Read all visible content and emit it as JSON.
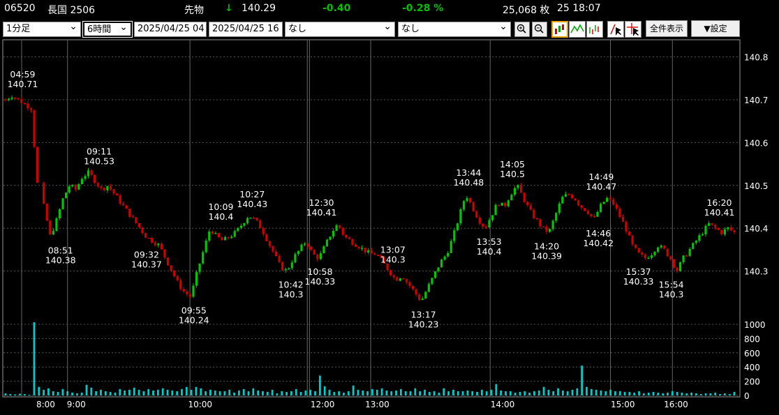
{
  "header": {
    "code": "06520",
    "name": "長国 2506",
    "kind": "先物",
    "arrow": "↓",
    "price": "140.29",
    "change": "-0.40",
    "change_pct": "-0.28 %",
    "volume": "25,068 枚",
    "datetime": "25 18:07",
    "colors": {
      "up": "#00c000",
      "text": "#ffffff"
    }
  },
  "toolbar": {
    "interval": "1分足",
    "span": "6時間",
    "from": "2025/04/25 04",
    "to": "2025/04/25 16",
    "indicator1": "なし",
    "indicator2": "なし",
    "zoom_in_icon": "zoom-in-icon",
    "zoom_out_icon": "zoom-out-icon",
    "show_all": "全件表示",
    "settings": "▼設定"
  },
  "chart_data": {
    "type": "candlestick",
    "y_ticks": [
      "140.8",
      "140.7",
      "140.6",
      "140.5",
      "140.4",
      "140.3"
    ],
    "ylim": [
      140.2,
      140.84
    ],
    "volume_ticks": [
      "1000",
      "800",
      "600",
      "400",
      "200",
      "0"
    ],
    "volume_lim": [
      0,
      1000
    ],
    "x_ticks": [
      "8:00",
      "9:00",
      "10:00",
      "12:00",
      "13:00",
      "14:00",
      "15:00",
      "16:00"
    ],
    "colors": {
      "up": "#00c800",
      "down": "#d00000",
      "volume": "#00cccc",
      "grid": "#666666"
    },
    "annotations": [
      {
        "time": "04:59",
        "price": "140.71",
        "pos": "above"
      },
      {
        "time": "08:51",
        "price": "140.38",
        "pos": "below"
      },
      {
        "time": "09:11",
        "price": "140.53",
        "pos": "above"
      },
      {
        "time": "09:32",
        "price": "140.37",
        "pos": "below"
      },
      {
        "time": "09:55",
        "price": "140.24",
        "pos": "below"
      },
      {
        "time": "10:09",
        "price": "140.4",
        "pos": "above"
      },
      {
        "time": "10:27",
        "price": "140.43",
        "pos": "above"
      },
      {
        "time": "10:42",
        "price": "140.3",
        "pos": "below"
      },
      {
        "time": "10:58",
        "price": "140.33",
        "pos": "below"
      },
      {
        "time": "12:30",
        "price": "140.41",
        "pos": "above"
      },
      {
        "time": "13:07",
        "price": "140.3",
        "pos": "above"
      },
      {
        "time": "13:17",
        "price": "140.23",
        "pos": "below"
      },
      {
        "time": "13:44",
        "price": "140.48",
        "pos": "above"
      },
      {
        "time": "13:53",
        "price": "140.4",
        "pos": "below"
      },
      {
        "time": "14:05",
        "price": "140.5",
        "pos": "above"
      },
      {
        "time": "14:20",
        "price": "140.39",
        "pos": "below"
      },
      {
        "time": "14:46",
        "price": "140.42",
        "pos": "below"
      },
      {
        "time": "14:49",
        "price": "140.47",
        "pos": "above"
      },
      {
        "time": "15:37",
        "price": "140.33",
        "pos": "below"
      },
      {
        "time": "15:54",
        "price": "140.3",
        "pos": "below"
      },
      {
        "time": "16:20",
        "price": "140.41",
        "pos": "above"
      }
    ],
    "price_path": [
      140.7,
      140.71,
      140.7,
      140.69,
      140.68,
      140.5,
      140.45,
      140.38,
      140.42,
      140.47,
      140.5,
      140.49,
      140.52,
      140.53,
      140.51,
      140.49,
      140.5,
      140.48,
      140.46,
      140.44,
      140.42,
      140.4,
      140.38,
      140.37,
      140.36,
      140.33,
      140.3,
      140.27,
      140.25,
      140.24,
      140.3,
      140.35,
      140.4,
      140.38,
      140.37,
      140.38,
      140.39,
      140.41,
      140.43,
      140.42,
      140.4,
      140.37,
      140.34,
      140.31,
      140.3,
      140.33,
      140.35,
      140.37,
      140.34,
      140.33,
      140.36,
      140.39,
      140.41,
      140.38,
      140.37,
      140.36,
      140.35,
      140.34,
      140.34,
      140.32,
      140.3,
      140.28,
      140.29,
      140.27,
      140.25,
      140.23,
      140.26,
      140.29,
      140.32,
      140.34,
      140.38,
      140.43,
      140.48,
      140.45,
      140.42,
      140.4,
      140.43,
      140.46,
      140.45,
      140.48,
      140.5,
      140.47,
      140.44,
      140.42,
      140.4,
      140.39,
      140.43,
      140.47,
      140.48,
      140.47,
      140.45,
      140.44,
      140.42,
      140.45,
      140.47,
      140.46,
      140.43,
      140.4,
      140.36,
      140.34,
      140.33,
      140.34,
      140.36,
      140.35,
      140.33,
      140.3,
      140.33,
      140.35,
      140.37,
      140.39,
      140.41,
      140.4,
      140.39,
      140.4,
      140.39
    ],
    "volumes": [
      30,
      20,
      15,
      25,
      20,
      10,
      1030,
      120,
      80,
      100,
      60,
      50,
      90,
      60,
      40,
      30,
      40,
      150,
      110,
      60,
      80,
      60,
      50,
      40,
      90,
      70,
      80,
      110,
      80,
      60,
      90,
      70,
      80,
      100,
      80,
      70,
      60,
      90,
      120,
      80,
      120,
      100,
      60,
      80,
      70,
      60,
      60,
      80,
      40,
      70,
      90,
      60,
      100,
      70,
      60,
      50,
      80,
      30,
      60,
      50,
      60,
      90,
      50,
      70,
      80,
      60,
      280,
      130,
      80,
      50,
      60,
      40,
      60,
      140,
      80,
      70,
      60,
      90,
      80,
      100,
      70,
      60,
      70,
      90,
      60,
      60,
      100,
      60,
      80,
      50,
      60,
      40,
      100,
      60,
      80,
      60,
      60,
      70,
      60,
      50,
      80,
      60,
      80,
      160,
      70,
      60,
      60,
      40,
      50,
      60,
      40,
      60,
      70,
      120,
      80,
      60,
      100,
      70,
      60,
      80,
      100,
      420,
      120,
      90,
      80,
      70,
      60,
      80,
      60,
      60,
      50,
      50,
      40,
      60,
      30,
      40,
      50,
      40,
      30,
      40,
      60,
      50,
      40,
      30,
      40,
      30,
      20,
      30,
      30,
      40,
      20,
      30,
      20,
      50
    ]
  }
}
